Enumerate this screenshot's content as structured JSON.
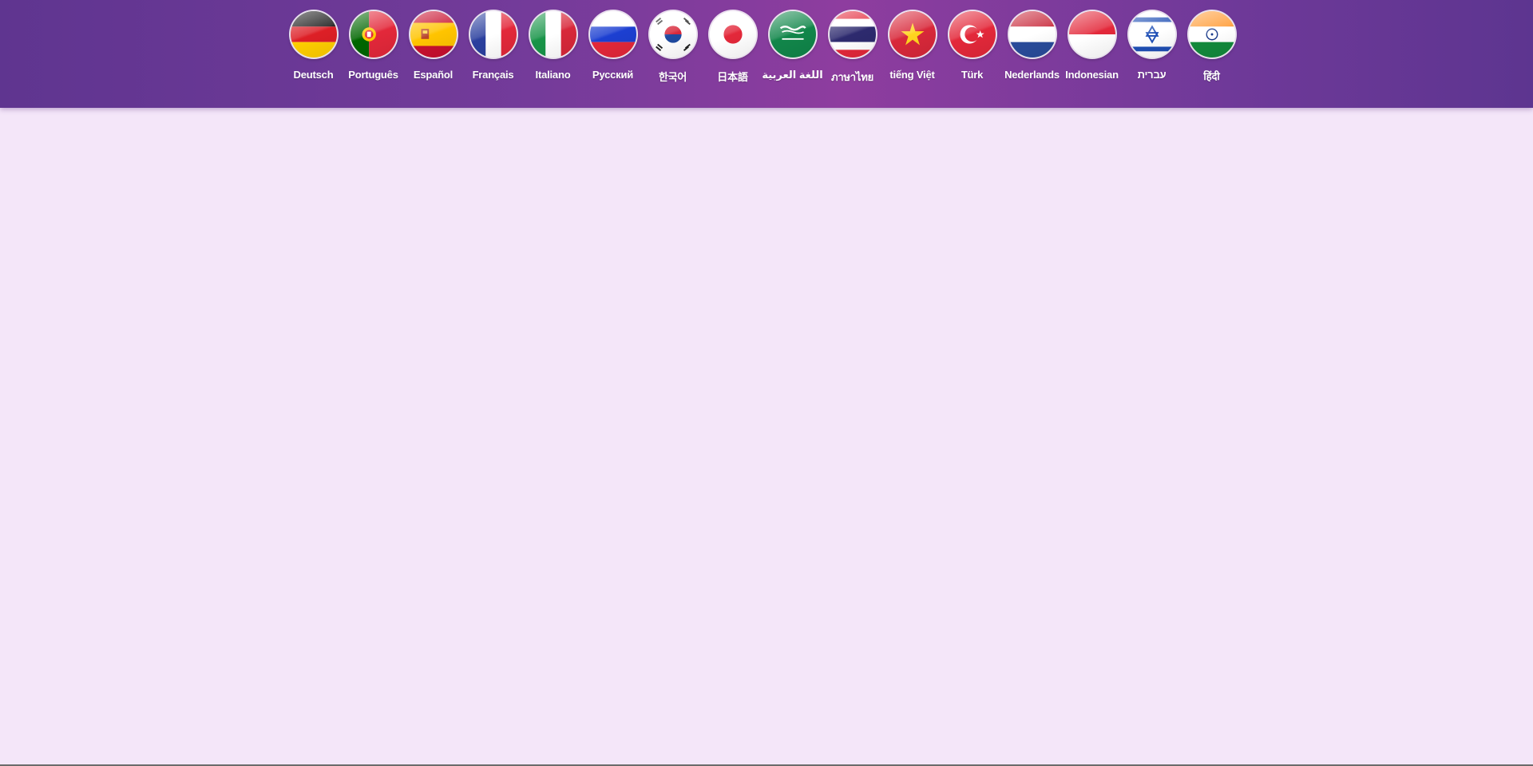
{
  "languages": [
    {
      "label": "Deutsch",
      "flag": "germany-flag-icon"
    },
    {
      "label": "Português",
      "flag": "portugal-flag-icon"
    },
    {
      "label": "Español",
      "flag": "spain-flag-icon"
    },
    {
      "label": "Français",
      "flag": "france-flag-icon"
    },
    {
      "label": "Italiano",
      "flag": "italy-flag-icon"
    },
    {
      "label": "Русский",
      "flag": "russia-flag-icon"
    },
    {
      "label": "한국어",
      "flag": "korea-flag-icon"
    },
    {
      "label": "日本語",
      "flag": "japan-flag-icon"
    },
    {
      "label": "اللغة العربية",
      "flag": "saudi-arabia-flag-icon"
    },
    {
      "label": "ภาษาไทย",
      "flag": "thailand-flag-icon"
    },
    {
      "label": "tiếng Việt",
      "flag": "vietnam-flag-icon"
    },
    {
      "label": "Türk",
      "flag": "turkey-flag-icon"
    },
    {
      "label": "Nederlands",
      "flag": "netherlands-flag-icon"
    },
    {
      "label": "Indonesian",
      "flag": "indonesia-flag-icon"
    },
    {
      "label": "עברית",
      "flag": "israel-flag-icon"
    },
    {
      "label": "हिंदी",
      "flag": "india-flag-icon"
    }
  ],
  "colors": {
    "header_start": "#5f3590",
    "header_mid": "#8e3d9f",
    "page_background": "#f4e6f9",
    "label_text": "#ffffff"
  }
}
